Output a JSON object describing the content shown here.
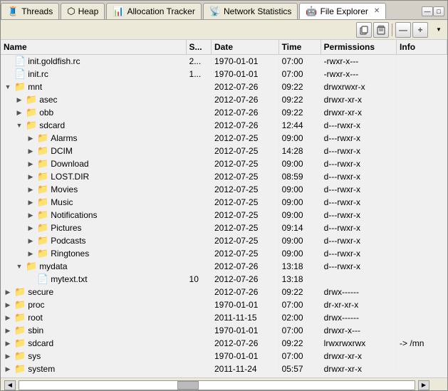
{
  "tabs": [
    {
      "id": "threads",
      "label": "Threads",
      "icon": "🧵",
      "active": false
    },
    {
      "id": "heap",
      "label": "Heap",
      "icon": "📦",
      "active": false
    },
    {
      "id": "allocation-tracker",
      "label": "Allocation Tracker",
      "icon": "📊",
      "active": false
    },
    {
      "id": "network-statistics",
      "label": "Network Statistics",
      "icon": "📡",
      "active": false
    },
    {
      "id": "file-explorer",
      "label": "File Explorer",
      "icon": "📁",
      "active": true
    }
  ],
  "toolbar": {
    "btn1": "📋",
    "btn2": "📋",
    "btn3": "—",
    "btn4": "+"
  },
  "columns": [
    "Name",
    "S...",
    "Date",
    "Time",
    "Permissions",
    "Info"
  ],
  "files": [
    {
      "indent": 0,
      "type": "file",
      "expand": "",
      "name": "init.goldfish.rc",
      "s": "2...",
      "date": "1970-01-01",
      "time": "07:00",
      "perms": "-rwxr-x---",
      "info": ""
    },
    {
      "indent": 0,
      "type": "file",
      "expand": "",
      "name": "init.rc",
      "s": "1...",
      "date": "1970-01-01",
      "time": "07:00",
      "perms": "-rwxr-x---",
      "info": ""
    },
    {
      "indent": 0,
      "type": "folder",
      "expand": "▼",
      "name": "mnt",
      "s": "",
      "date": "2012-07-26",
      "time": "09:22",
      "perms": "drwxrwxr-x",
      "info": ""
    },
    {
      "indent": 1,
      "type": "folder",
      "expand": "▶",
      "name": "asec",
      "s": "",
      "date": "2012-07-26",
      "time": "09:22",
      "perms": "drwxr-xr-x",
      "info": ""
    },
    {
      "indent": 1,
      "type": "folder",
      "expand": "▶",
      "name": "obb",
      "s": "",
      "date": "2012-07-26",
      "time": "09:22",
      "perms": "drwxr-xr-x",
      "info": ""
    },
    {
      "indent": 1,
      "type": "folder",
      "expand": "▼",
      "name": "sdcard",
      "s": "",
      "date": "2012-07-26",
      "time": "12:44",
      "perms": "d---rwxr-x",
      "info": ""
    },
    {
      "indent": 2,
      "type": "folder",
      "expand": "▶",
      "name": "Alarms",
      "s": "",
      "date": "2012-07-25",
      "time": "09:00",
      "perms": "d---rwxr-x",
      "info": ""
    },
    {
      "indent": 2,
      "type": "folder",
      "expand": "▶",
      "name": "DCIM",
      "s": "",
      "date": "2012-07-25",
      "time": "14:28",
      "perms": "d---rwxr-x",
      "info": ""
    },
    {
      "indent": 2,
      "type": "folder",
      "expand": "▶",
      "name": "Download",
      "s": "",
      "date": "2012-07-25",
      "time": "09:00",
      "perms": "d---rwxr-x",
      "info": ""
    },
    {
      "indent": 2,
      "type": "folder",
      "expand": "▶",
      "name": "LOST.DIR",
      "s": "",
      "date": "2012-07-25",
      "time": "08:59",
      "perms": "d---rwxr-x",
      "info": ""
    },
    {
      "indent": 2,
      "type": "folder",
      "expand": "▶",
      "name": "Movies",
      "s": "",
      "date": "2012-07-25",
      "time": "09:00",
      "perms": "d---rwxr-x",
      "info": ""
    },
    {
      "indent": 2,
      "type": "folder",
      "expand": "▶",
      "name": "Music",
      "s": "",
      "date": "2012-07-25",
      "time": "09:00",
      "perms": "d---rwxr-x",
      "info": ""
    },
    {
      "indent": 2,
      "type": "folder",
      "expand": "▶",
      "name": "Notifications",
      "s": "",
      "date": "2012-07-25",
      "time": "09:00",
      "perms": "d---rwxr-x",
      "info": ""
    },
    {
      "indent": 2,
      "type": "folder",
      "expand": "▶",
      "name": "Pictures",
      "s": "",
      "date": "2012-07-25",
      "time": "09:14",
      "perms": "d---rwxr-x",
      "info": ""
    },
    {
      "indent": 2,
      "type": "folder",
      "expand": "▶",
      "name": "Podcasts",
      "s": "",
      "date": "2012-07-25",
      "time": "09:00",
      "perms": "d---rwxr-x",
      "info": ""
    },
    {
      "indent": 2,
      "type": "folder",
      "expand": "▶",
      "name": "Ringtones",
      "s": "",
      "date": "2012-07-25",
      "time": "09:00",
      "perms": "d---rwxr-x",
      "info": ""
    },
    {
      "indent": 1,
      "type": "folder",
      "expand": "▼",
      "name": "mydata",
      "s": "",
      "date": "2012-07-26",
      "time": "13:18",
      "perms": "d---rwxr-x",
      "info": ""
    },
    {
      "indent": 2,
      "type": "file",
      "expand": "",
      "name": "mytext.txt",
      "s": "10",
      "date": "2012-07-26",
      "time": "13:18",
      "perms": "",
      "info": ""
    },
    {
      "indent": 0,
      "type": "folder",
      "expand": "▶",
      "name": "secure",
      "s": "",
      "date": "2012-07-26",
      "time": "09:22",
      "perms": "drwx------",
      "info": ""
    },
    {
      "indent": 0,
      "type": "folder",
      "expand": "▶",
      "name": "proc",
      "s": "",
      "date": "1970-01-01",
      "time": "07:00",
      "perms": "dr-xr-xr-x",
      "info": ""
    },
    {
      "indent": 0,
      "type": "folder",
      "expand": "▶",
      "name": "root",
      "s": "",
      "date": "2011-11-15",
      "time": "02:00",
      "perms": "drwx------",
      "info": ""
    },
    {
      "indent": 0,
      "type": "folder",
      "expand": "▶",
      "name": "sbin",
      "s": "",
      "date": "1970-01-01",
      "time": "07:00",
      "perms": "drwxr-x---",
      "info": ""
    },
    {
      "indent": 0,
      "type": "folder",
      "expand": "▶",
      "name": "sdcard",
      "s": "",
      "date": "2012-07-26",
      "time": "09:22",
      "perms": "lrwxrwxrwx",
      "info": "-> /mn"
    },
    {
      "indent": 0,
      "type": "folder",
      "expand": "▶",
      "name": "sys",
      "s": "",
      "date": "1970-01-01",
      "time": "07:00",
      "perms": "drwxr-xr-x",
      "info": ""
    },
    {
      "indent": 0,
      "type": "folder",
      "expand": "▶",
      "name": "system",
      "s": "",
      "date": "2011-11-24",
      "time": "05:57",
      "perms": "drwxr-xr-x",
      "info": ""
    }
  ],
  "statusbar": {
    "scroll_indicator": "|||"
  }
}
